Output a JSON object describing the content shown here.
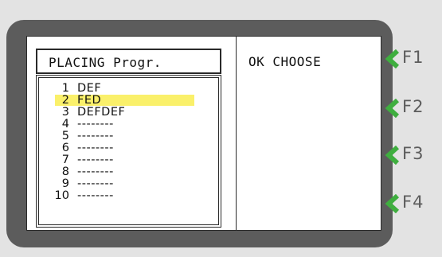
{
  "screen": {
    "title": "PLACING Progr.",
    "right_label": "OK CHOOSE",
    "programs": [
      {
        "num": "1",
        "name": "DEF",
        "selected": false
      },
      {
        "num": "2",
        "name": "FED",
        "selected": true
      },
      {
        "num": "3",
        "name": "DEFDEF",
        "selected": false
      },
      {
        "num": "4",
        "name": "--------",
        "selected": false
      },
      {
        "num": "5",
        "name": "--------",
        "selected": false
      },
      {
        "num": "6",
        "name": "--------",
        "selected": false
      },
      {
        "num": "7",
        "name": "--------",
        "selected": false
      },
      {
        "num": "8",
        "name": "--------",
        "selected": false
      },
      {
        "num": "9",
        "name": "--------",
        "selected": false
      },
      {
        "num": "10",
        "name": "--------",
        "selected": false
      }
    ]
  },
  "function_keys": [
    {
      "label": "F1"
    },
    {
      "label": "F2"
    },
    {
      "label": "F3"
    },
    {
      "label": "F4"
    }
  ],
  "colors": {
    "background": "#e3e3e3",
    "bezel": "#5c5c5c",
    "screen": "#ffffff",
    "highlight": "#faf06a",
    "accent": "#3fae3f"
  }
}
